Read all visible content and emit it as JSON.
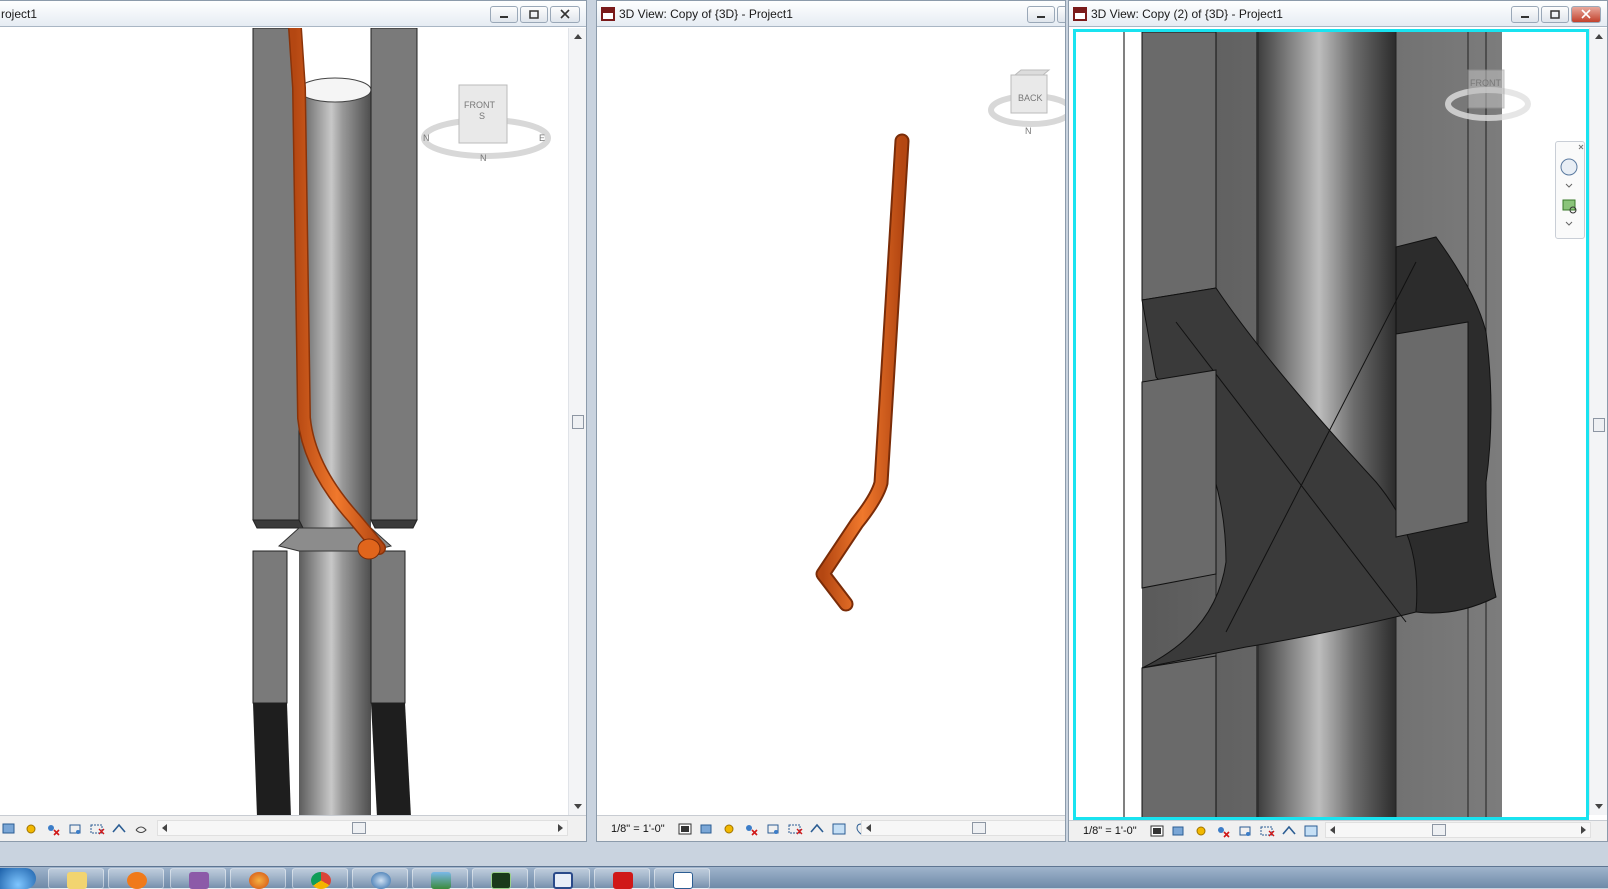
{
  "views": {
    "left": {
      "title": "roject1",
      "scale": ""
    },
    "middle": {
      "title": "3D View: Copy of {3D} - Project1",
      "scale": "1/8\" = 1'-0\""
    },
    "right": {
      "title": "3D View: Copy (2) of {3D} - Project1",
      "scale": "1/8\" = 1'-0\""
    }
  },
  "viewcube": {
    "left": {
      "face": "FRONT",
      "compass_s": "S",
      "compass_n": "N",
      "compass_e": "E",
      "compass_w": "N"
    },
    "middle": {
      "face": "BACK",
      "compass_n": "N"
    },
    "right": {
      "face": "FRONT"
    }
  },
  "colors": {
    "pipe": "#e0651c",
    "active_border": "#19e3f0",
    "steel": "#808080"
  },
  "taskbar": {
    "items": [
      "start-orb-icon",
      "windows-explorer-icon",
      "media-player-icon",
      "revit-icon",
      "firefox-icon",
      "chrome-icon",
      "itunes-icon",
      "photo-viewer-icon",
      "monitor-icon",
      "p-app-icon",
      "acrobat-icon",
      "text-editor-icon"
    ]
  }
}
